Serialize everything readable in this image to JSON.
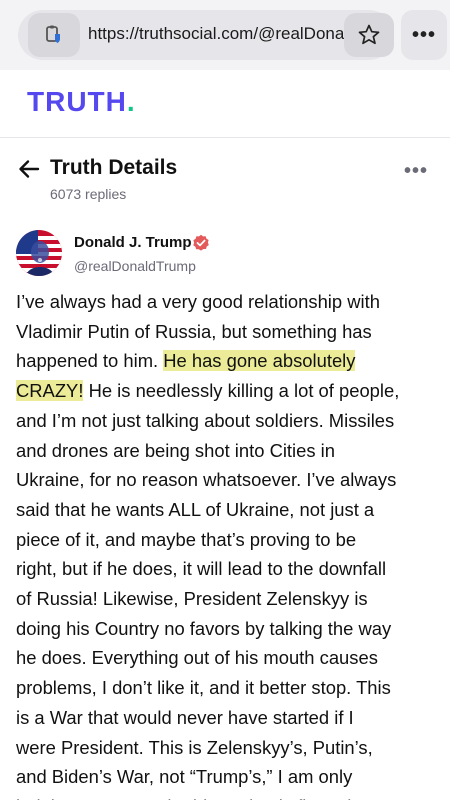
{
  "browser": {
    "url": "https://truthsocial.com/@realDona...",
    "icons": [
      "site-info-icon",
      "star-icon",
      "more-icon"
    ],
    "menu_label": "•••"
  },
  "app": {
    "logo_text": "TRUTH",
    "logo_dot": ".",
    "colors": {
      "brand": "#5448ee",
      "brand_dot": "#11c48a",
      "verified": "#e45a5a",
      "highlight": "#ecec98"
    }
  },
  "header": {
    "title": "Truth Details",
    "reply_count": "6073 replies",
    "more_label": "•••"
  },
  "author": {
    "name": "Donald J. Trump",
    "handle": "@realDonaldTrump",
    "verified": true
  },
  "post": {
    "lines": [
      {
        "text": "I’ve always had a very good relationship with"
      },
      {
        "text": "Vladimir Putin of Russia, but something has"
      },
      {
        "pre": "happened to him. ",
        "hl": "He has gone absolutely"
      },
      {
        "hl": "CRAZY!",
        "post": " He is needlessly killing a lot of people,"
      },
      {
        "text": "and I’m not just talking about soldiers. Missiles"
      },
      {
        "text": "and drones are being shot into Cities in"
      },
      {
        "text": "Ukraine, for no reason whatsoever. I’ve always"
      },
      {
        "text": "said that he wants ALL of Ukraine, not just a"
      },
      {
        "text": "piece of it, and maybe that’s proving to be"
      },
      {
        "text": "right, but if he does, it will lead to the downfall"
      },
      {
        "text": "of Russia! Likewise, President Zelenskyy is"
      },
      {
        "text": "doing his Country no favors by talking the way"
      },
      {
        "text": "he does. Everything out of his mouth causes"
      },
      {
        "text": "problems, I don’t like it, and it better stop. This"
      },
      {
        "text": "is a War that would never have started if I"
      },
      {
        "text": "were President. This is Zelenskyy’s, Putin’s,"
      },
      {
        "text": "and Biden’s War, not “Trump’s,” I am only"
      },
      {
        "text": "helping to put out the big and ugly fires, that"
      }
    ]
  }
}
